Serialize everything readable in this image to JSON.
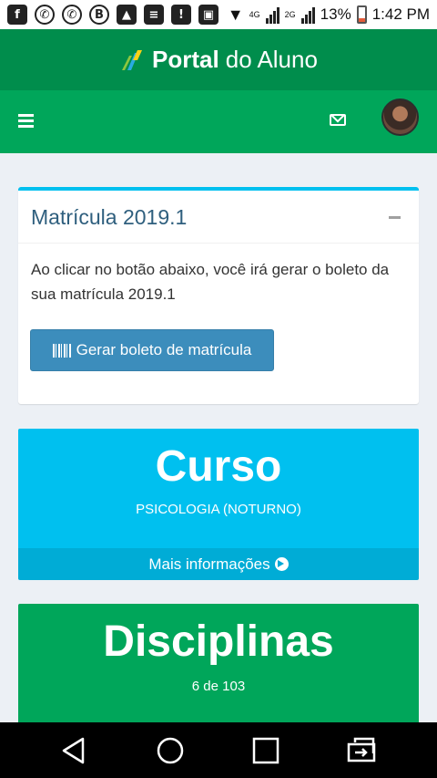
{
  "status_bar": {
    "icons": [
      "facebook-icon",
      "whatsapp-icon",
      "whatsapp-icon",
      "b-icon",
      "image-icon",
      "message-icon",
      "alert-message-icon",
      "sim-icon",
      "wifi-icon",
      "signal-4g-icon",
      "signal-2g-icon"
    ],
    "net_4g": "4G",
    "net_2g": "2G",
    "battery": "13%",
    "time": "1:42 PM"
  },
  "brand": {
    "bold": "Portal",
    "light": "do Aluno"
  },
  "box": {
    "title": "Matrícula 2019.1",
    "body": "Ao clicar no botão abaixo, você irá gerar o boleto da sua matrícula 2019.1",
    "button_label": "Gerar boleto de matrícula"
  },
  "curso": {
    "heading": "Curso",
    "value": "PSICOLOGIA (NOTURNO)",
    "footer": "Mais informações"
  },
  "disciplinas": {
    "heading": "Disciplinas",
    "value": "6 de 103"
  },
  "colors": {
    "brand_dark": "#008d4c",
    "brand": "#00a65a",
    "info": "#00c0ef",
    "primary": "#3c8dbc"
  }
}
